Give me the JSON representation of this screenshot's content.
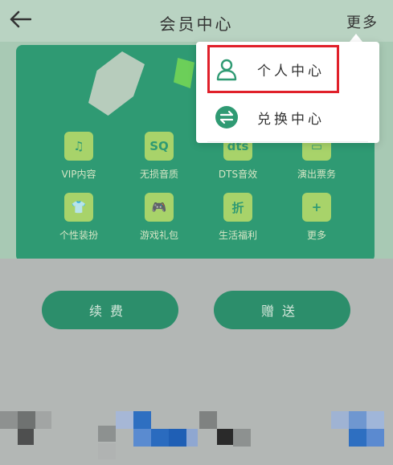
{
  "header": {
    "title": "会员中心",
    "more_label": "更多",
    "back_icon": "arrow-left-icon"
  },
  "grid": [
    {
      "label": "VIP内容",
      "icon": "music-note-icon",
      "glyph": "♫"
    },
    {
      "label": "无损音质",
      "icon": "sq-quality-icon",
      "glyph": "SQ"
    },
    {
      "label": "DTS音效",
      "icon": "dts-icon",
      "glyph": "dts"
    },
    {
      "label": "演出票务",
      "icon": "ticket-icon",
      "glyph": "▭"
    },
    {
      "label": "个性装扮",
      "icon": "tshirt-icon",
      "glyph": "👕"
    },
    {
      "label": "游戏礼包",
      "icon": "gamepad-icon",
      "glyph": "🎮"
    },
    {
      "label": "生活福利",
      "icon": "discount-icon",
      "glyph": "折"
    },
    {
      "label": "更多",
      "icon": "plus-icon",
      "glyph": "+"
    }
  ],
  "buttons": {
    "renew": "续费",
    "gift": "赠送"
  },
  "dropdown": {
    "items": [
      {
        "label": "个人中心",
        "icon": "person-icon"
      },
      {
        "label": "兑换中心",
        "icon": "exchange-icon"
      }
    ],
    "accent": "#2f9a73",
    "highlight_color": "#e0202a"
  }
}
